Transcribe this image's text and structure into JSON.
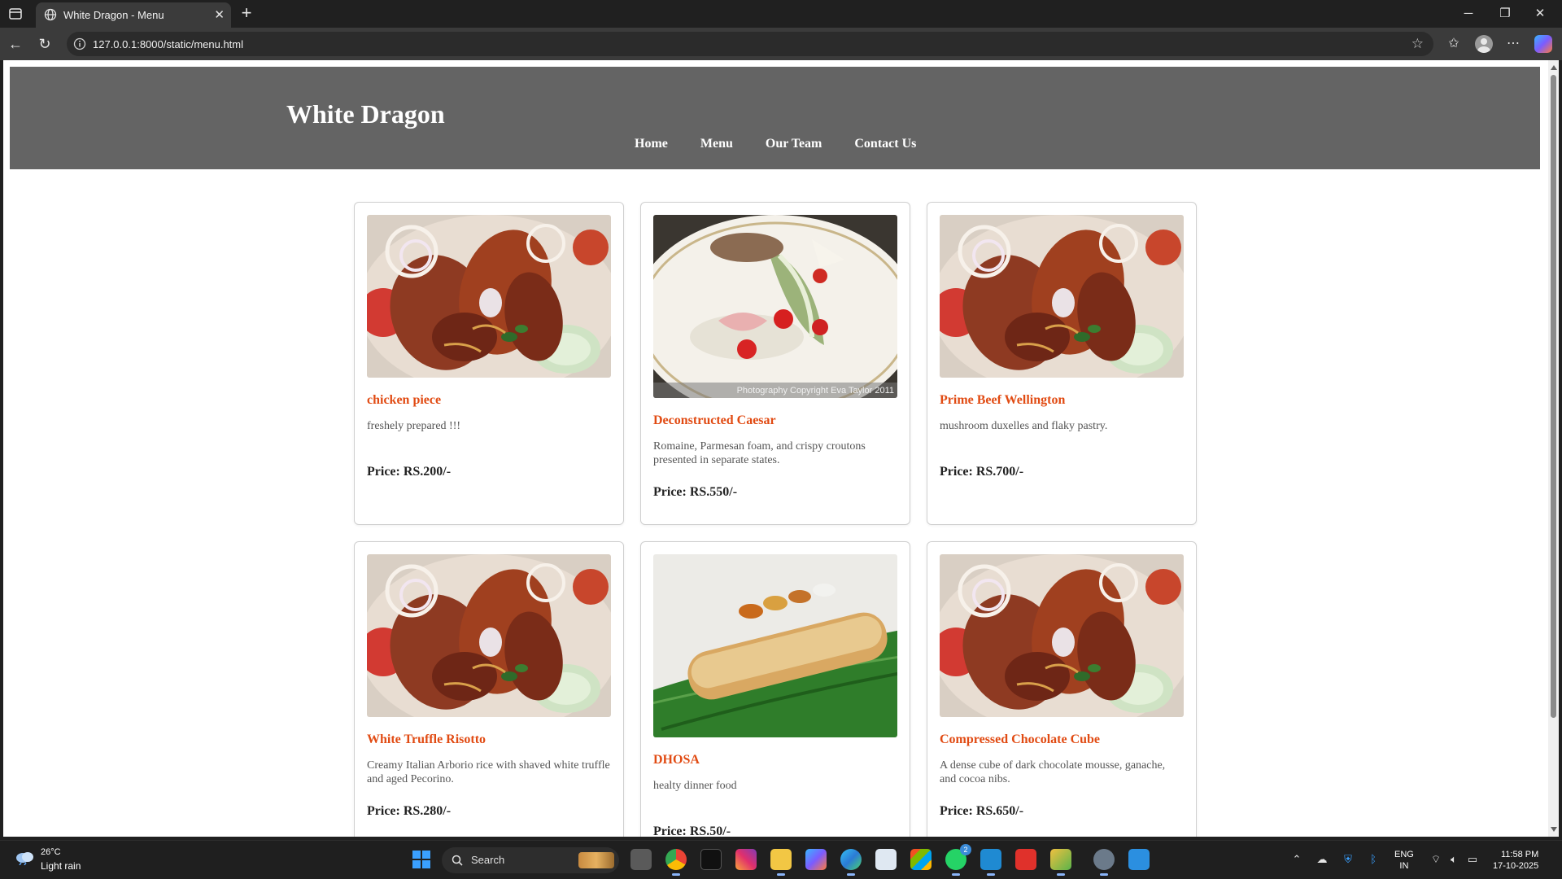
{
  "browser": {
    "tab_title": "White Dragon - Menu",
    "url": "127.0.0.1:8000/static/menu.html"
  },
  "site": {
    "title": "White Dragon",
    "nav": [
      "Home",
      "Menu",
      "Our Team",
      "Contact Us"
    ]
  },
  "menu": {
    "items": [
      {
        "name": "chicken piece",
        "desc": "freshely prepared !!!",
        "price": "Price: RS.200/-",
        "image": "tandoori-prawns-photo"
      },
      {
        "name": "Deconstructed Caesar",
        "desc": "Romaine, Parmesan foam, and crispy croutons presented in separate states.",
        "price": "Price: RS.550/-",
        "image": "caesar-salad-photo",
        "image_caption": "Photography Copyright Eva Taylor 2011"
      },
      {
        "name": "Prime Beef Wellington",
        "desc": "mushroom duxelles and flaky pastry.",
        "price": "Price: RS.700/-",
        "image": "tandoori-prawns-photo"
      },
      {
        "name": "White Truffle Risotto",
        "desc": "Creamy Italian Arborio rice with shaved white truffle and aged Pecorino.",
        "price": "Price: RS.280/-",
        "image": "tandoori-prawns-photo"
      },
      {
        "name": "DHOSA",
        "desc": "healty dinner food",
        "price": "Price: RS.50/-",
        "image": "dosa-on-banana-leaf-photo"
      },
      {
        "name": "Compressed Chocolate Cube",
        "desc": "A dense cube of dark chocolate mousse, ganache, and cocoa nibs.",
        "price": "Price: RS.650/-",
        "image": "tandoori-prawns-photo"
      }
    ]
  },
  "taskbar": {
    "weather_temp": "26°C",
    "weather_condition": "Light rain",
    "search_placeholder": "Search",
    "lang_top": "ENG",
    "lang_bottom": "IN",
    "time": "11:58 PM",
    "date": "17-10-2025",
    "whatsapp_badge": "2"
  },
  "colors": {
    "header_bg": "#646464",
    "item_name": "#e14b13",
    "page_bg": "#ffffff"
  }
}
